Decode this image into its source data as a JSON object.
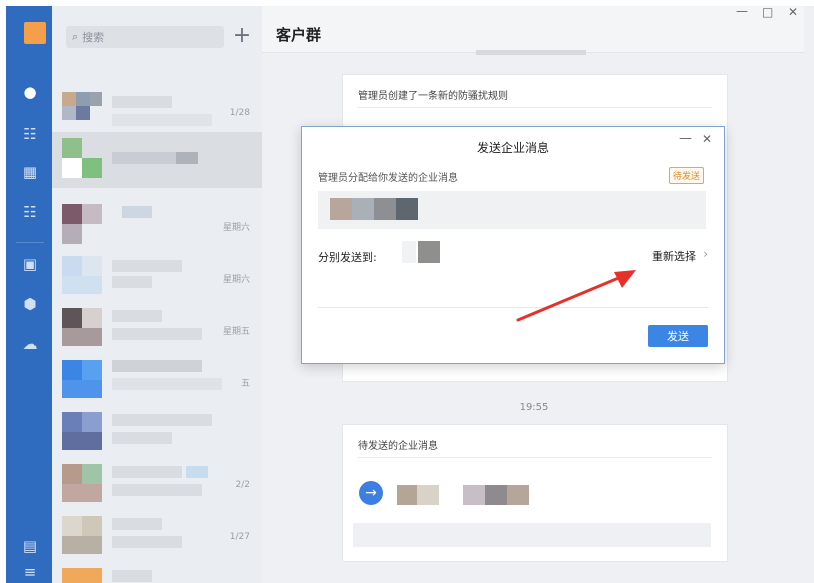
{
  "sidebar": {
    "icons": [
      "chat-icon",
      "org-icon",
      "calendar-icon",
      "workbench-icon",
      "doc-icon",
      "box-icon",
      "cloud-icon",
      "notes-icon",
      "menu-icon"
    ]
  },
  "list": {
    "search_placeholder": "搜索",
    "add_label": "+",
    "items": [
      {
        "time": "1/28"
      },
      {
        "time": ""
      },
      {
        "time": "星期六"
      },
      {
        "time": "星期六"
      },
      {
        "time": "星期五"
      },
      {
        "time": "五"
      },
      {
        "time": ""
      },
      {
        "time": "2/2"
      },
      {
        "time": "1/27"
      }
    ]
  },
  "header": {
    "title": "客户群",
    "min": "—",
    "max": "□",
    "close": "✕"
  },
  "chat": {
    "card1_title": "管理员创建了一条新的防骚扰规则",
    "timestamp2": "19:55",
    "card2_title": "待发送的企业消息",
    "card2_arrow": "→"
  },
  "dialog": {
    "title": "发送企业消息",
    "min": "—",
    "close": "✕",
    "subtitle": "管理员分配给你发送的企业消息",
    "badge": "待发送",
    "send_to_label": "分别发送到:",
    "reselect_label": "重新选择",
    "chevron": "›",
    "send_button": "发送"
  },
  "colors": {
    "rail": "#2f6bbf",
    "accent": "#3b86e5",
    "badge": "#e08a2a",
    "arrow": "#e8302a"
  }
}
